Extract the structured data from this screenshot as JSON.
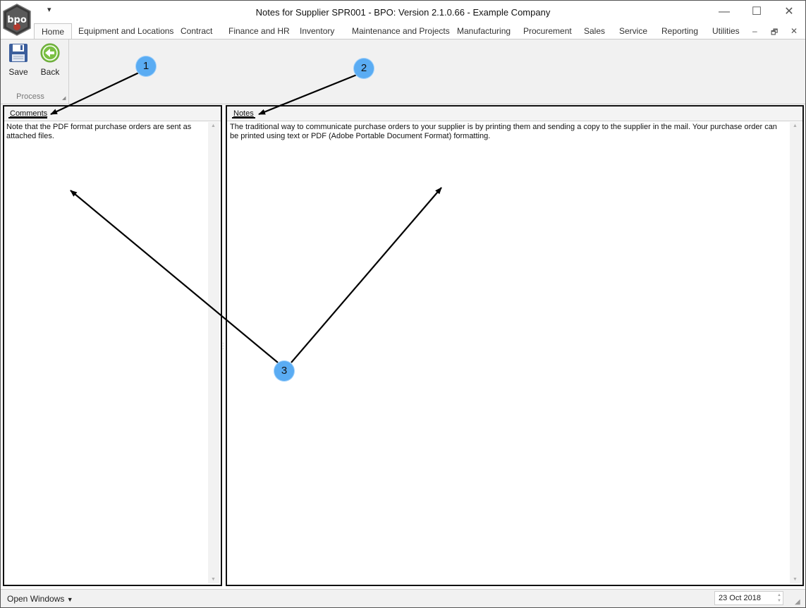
{
  "window": {
    "title": "Notes for Supplier SPR001 - BPO: Version 2.1.0.66 - Example Company",
    "logo_text": "bpo",
    "qat_icon": "caret-down-icon",
    "controls": {
      "minimize": "—",
      "maximize": "☐",
      "close": "✕"
    }
  },
  "tabs": [
    {
      "label": "Home",
      "active": true
    },
    {
      "label": "Equipment and Locations"
    },
    {
      "label": "Contract"
    },
    {
      "label": "Finance and HR"
    },
    {
      "label": "Inventory"
    },
    {
      "label": "Maintenance and Projects"
    },
    {
      "label": "Manufacturing"
    },
    {
      "label": "Procurement"
    },
    {
      "label": "Sales"
    },
    {
      "label": "Service"
    },
    {
      "label": "Reporting"
    },
    {
      "label": "Utilities"
    }
  ],
  "mdi_controls": {
    "minimize": "–",
    "restore": "🗗",
    "close": "✕"
  },
  "ribbon": {
    "group_label": "Process",
    "buttons": [
      {
        "label": "Save",
        "icon": "floppy-disk-icon"
      },
      {
        "label": "Back",
        "icon": "back-arrow-icon"
      }
    ],
    "colors": {
      "save_icon": "#3b5e9c",
      "back_icon": "#7ac043"
    }
  },
  "comments": {
    "title": "Comments",
    "text": "Note that the PDF format purchase orders are sent as attached files."
  },
  "notes": {
    "title": "Notes",
    "text": "The traditional way to communicate purchase orders to your supplier is by printing them and sending a copy to the supplier in the mail. Your purchase order can be printed using text or PDF (Adobe Portable Document Format) formatting."
  },
  "statusbar": {
    "open_windows": "Open Windows",
    "date": "23 Oct 2018"
  },
  "callouts": [
    "1",
    "2",
    "3"
  ],
  "colors": {
    "callout": "#5aacf3",
    "panel_border": "#111111"
  }
}
